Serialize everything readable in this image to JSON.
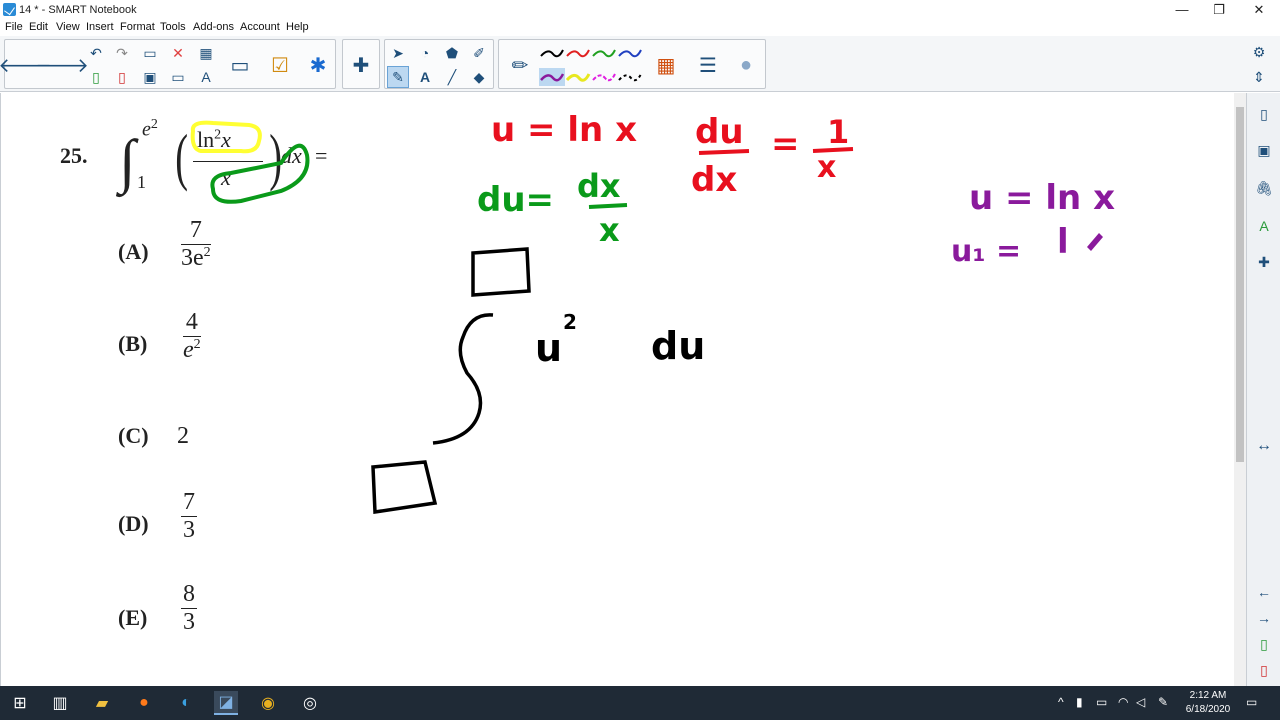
{
  "window": {
    "title": "14 * - SMART Notebook",
    "minimize": "—",
    "maximize": "❐",
    "close": "✕"
  },
  "menu": [
    "File",
    "Edit",
    "View",
    "Insert",
    "Format",
    "Tools",
    "Add-ons",
    "Account",
    "Help"
  ],
  "problem": {
    "number": "25.",
    "upper_limit": "e",
    "upper_exp": "2",
    "lower_limit": "1",
    "numerator_fn": "ln",
    "numerator_exp": "2",
    "numerator_var": "x",
    "denominator": "x",
    "differential": "dx",
    "equals": "=",
    "choices": [
      {
        "letter": "(A)",
        "numer": "7",
        "denom": "3e",
        "denom_exp": "2"
      },
      {
        "letter": "(B)",
        "numer": "4",
        "denom": "e",
        "denom_exp": "2"
      },
      {
        "letter": "(C)",
        "value": "2"
      },
      {
        "letter": "(D)",
        "numer": "7",
        "denom": "3"
      },
      {
        "letter": "(E)",
        "numer": "8",
        "denom": "3"
      }
    ]
  },
  "ink": {
    "red_sub": "u = ln x",
    "red_deriv_num": "du",
    "red_deriv_den": "dx",
    "red_equals": "=",
    "red_rhs_num": "1",
    "red_rhs_den": "x",
    "green_du": "du=",
    "green_num": "dx",
    "green_den": "x",
    "purple_1": "u = ln x",
    "purple_2": "u₁ =",
    "purple_3": "l",
    "black_u": "u",
    "black_exp": "2",
    "black_du": "du"
  },
  "taskbar": {
    "time": "2:12 AM",
    "date": "6/18/2020"
  },
  "colors": {
    "red": "#e8101e",
    "green": "#0a9a1a",
    "purple": "#8a1a9c",
    "black": "#000000",
    "highlight_yellow": "#ffff33"
  }
}
